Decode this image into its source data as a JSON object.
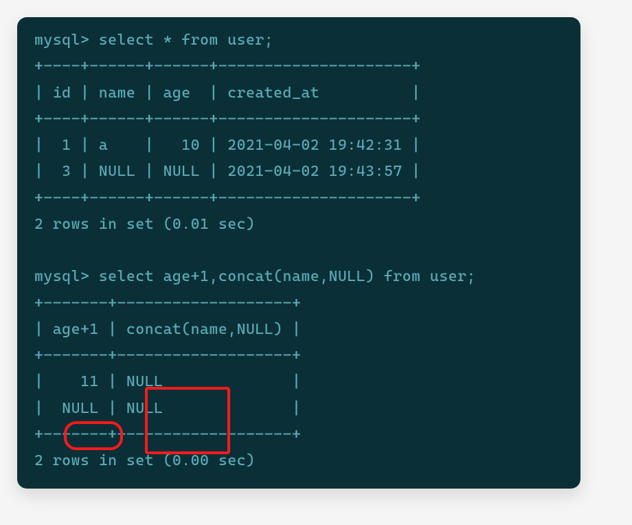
{
  "prompt": "mysql>",
  "query1": "select * from user;",
  "table1": {
    "sep": "+----+------+------+---------------------+",
    "header": "| id | name | age  | created_at          |",
    "row1": "|  1 | a    |   10 | 2021-04-02 19:42:31 |",
    "row2": "|  3 | NULL | NULL | 2021-04-02 19:43:57 |"
  },
  "status1": "2 rows in set (0.01 sec)",
  "query2": "select age+1,concat(name,NULL) from user;",
  "table2": {
    "sep": "+-------+-------------------+",
    "header": "| age+1 | concat(name,NULL) |",
    "row1": "|    11 | NULL              |",
    "row2": "|  NULL | NULL              |"
  },
  "status2": "2 rows in set (0.00 sec)"
}
